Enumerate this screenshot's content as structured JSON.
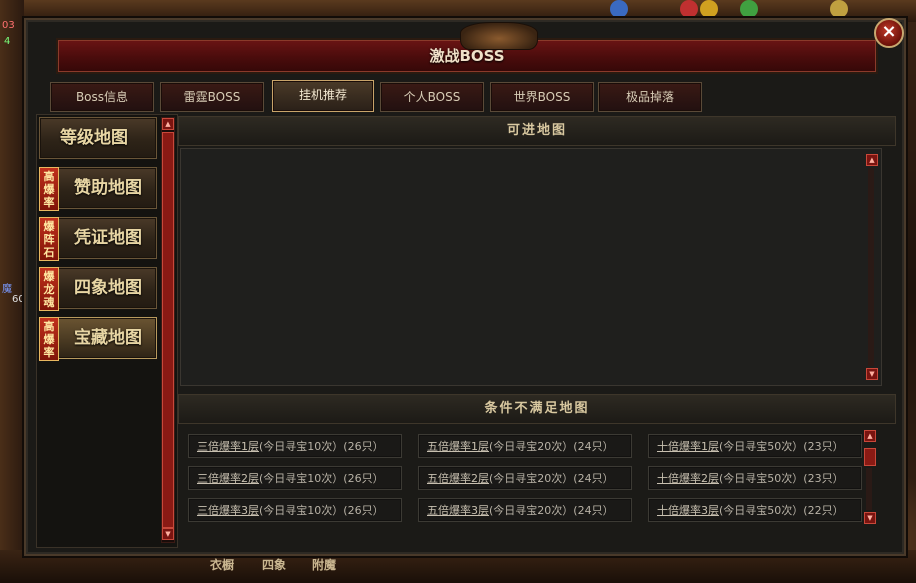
{
  "dialog": {
    "title": "激战BOSS",
    "close_glyph": "×"
  },
  "tabs": [
    {
      "label": "Boss信息",
      "active": false
    },
    {
      "label": "雷霆BOSS",
      "active": false
    },
    {
      "label": "挂机推荐",
      "active": true
    },
    {
      "label": "个人BOSS",
      "active": false
    },
    {
      "label": "世界BOSS",
      "active": false
    },
    {
      "label": "极品掉落",
      "active": false
    }
  ],
  "sidebar": {
    "items": [
      {
        "label": "等级地图",
        "badge": "",
        "highlight": false
      },
      {
        "label": "赞助地图",
        "badge": "高爆率",
        "highlight": false
      },
      {
        "label": "凭证地图",
        "badge": "爆阵石",
        "highlight": false
      },
      {
        "label": "四象地图",
        "badge": "爆龙魂",
        "highlight": false
      },
      {
        "label": "宝藏地图",
        "badge": "高爆率",
        "highlight": true
      }
    ]
  },
  "panel": {
    "available_header": "可进地图",
    "unavailable_header": "条件不满足地图",
    "rows": [
      [
        {
          "floor": "三倍爆率1层",
          "detail": "(今日寻宝10次）(26只）"
        },
        {
          "floor": "五倍爆率1层",
          "detail": "(今日寻宝20次）(24只）"
        },
        {
          "floor": "十倍爆率1层",
          "detail": "(今日寻宝50次）(23只）"
        }
      ],
      [
        {
          "floor": "三倍爆率2层",
          "detail": "(今日寻宝10次）(26只）"
        },
        {
          "floor": "五倍爆率2层",
          "detail": "(今日寻宝20次）(24只）"
        },
        {
          "floor": "十倍爆率2层",
          "detail": "(今日寻宝50次）(23只）"
        }
      ],
      [
        {
          "floor": "三倍爆率3层",
          "detail": "(今日寻宝10次）(26只）"
        },
        {
          "floor": "五倍爆率3层",
          "detail": "(今日寻宝20次）(24只）"
        },
        {
          "floor": "十倍爆率3层",
          "detail": "(今日寻宝50次）(22只）"
        }
      ]
    ]
  },
  "hud": {
    "left_texts": [
      "03",
      "4",
      "魔",
      "60"
    ],
    "bottom_labels": [
      "衣橱",
      "四象",
      "附魔"
    ]
  },
  "colors": {
    "title_bar": "#5a1010",
    "accent_gold": "#c8a46a",
    "scroll_red": "#7a1410"
  }
}
